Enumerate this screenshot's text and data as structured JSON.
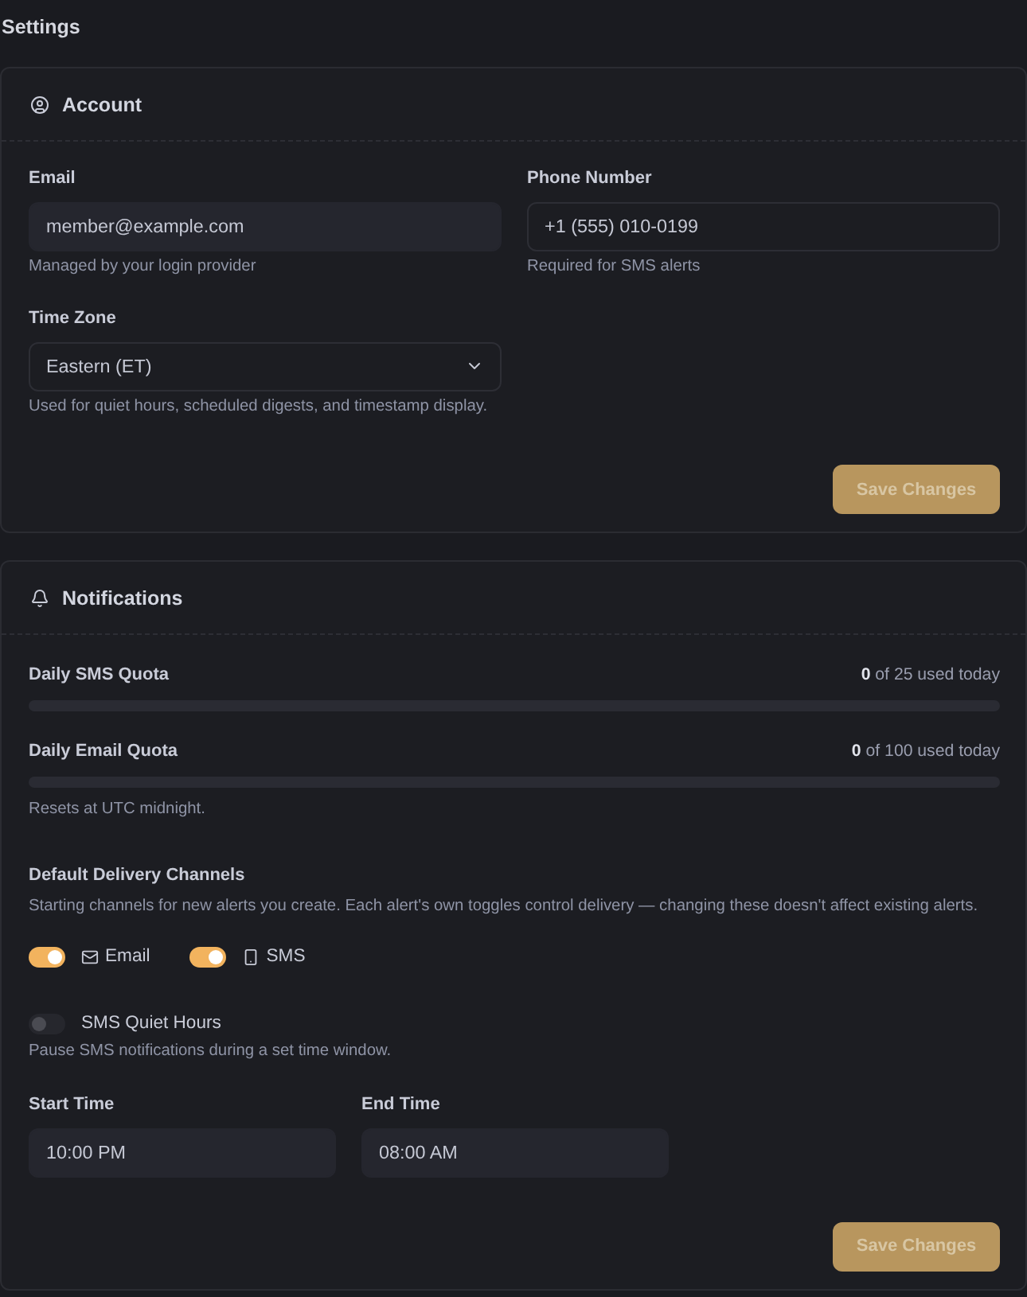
{
  "page": {
    "title": "Settings"
  },
  "account": {
    "title": "Account",
    "fields": [
      {
        "kind": "text",
        "label": "Email",
        "value": "member@example.com",
        "disabled": true,
        "hint": "Managed by your login provider"
      },
      {
        "kind": "text",
        "label": "Phone Number",
        "value": "+1 (555) 010-0199",
        "disabled": false,
        "hint": "Required for SMS alerts"
      },
      {
        "kind": "select",
        "label": "Time Zone",
        "value": "Eastern (ET)",
        "disabled": false,
        "hint": "Used for quiet hours, scheduled digests, and timestamp display."
      }
    ],
    "save_button": {
      "label": "Save Changes",
      "disabled": true
    }
  },
  "notifications": {
    "title": "Notifications",
    "quotas": [
      {
        "label": "Daily SMS Quota",
        "reading": "**0** of 25 used today",
        "level": 0
      },
      {
        "label": "Daily Email Quota",
        "reading": "**0** of 100 used today",
        "level": 0
      }
    ],
    "quota_note": "Resets at UTC midnight.",
    "delivery": {
      "title": "Default Delivery Channels",
      "description": "Starting channels for new alerts you create. Each alert's own toggles control delivery — changing these doesn't affect existing alerts.",
      "channels": [
        {
          "kind": "email",
          "label": "Email",
          "on": true
        },
        {
          "kind": "sms",
          "label": "SMS",
          "on": true
        }
      ]
    },
    "quiet_hours": {
      "label": "SMS Quiet Hours",
      "on": false,
      "hint": "Pause SMS notifications during a set time window."
    },
    "times": [
      {
        "label": "Start Time",
        "value": "10:00 PM",
        "disabled": true
      },
      {
        "label": "End Time",
        "value": "08:00 AM",
        "disabled": true
      }
    ],
    "save_button": {
      "label": "Save Changes",
      "disabled": true
    }
  }
}
